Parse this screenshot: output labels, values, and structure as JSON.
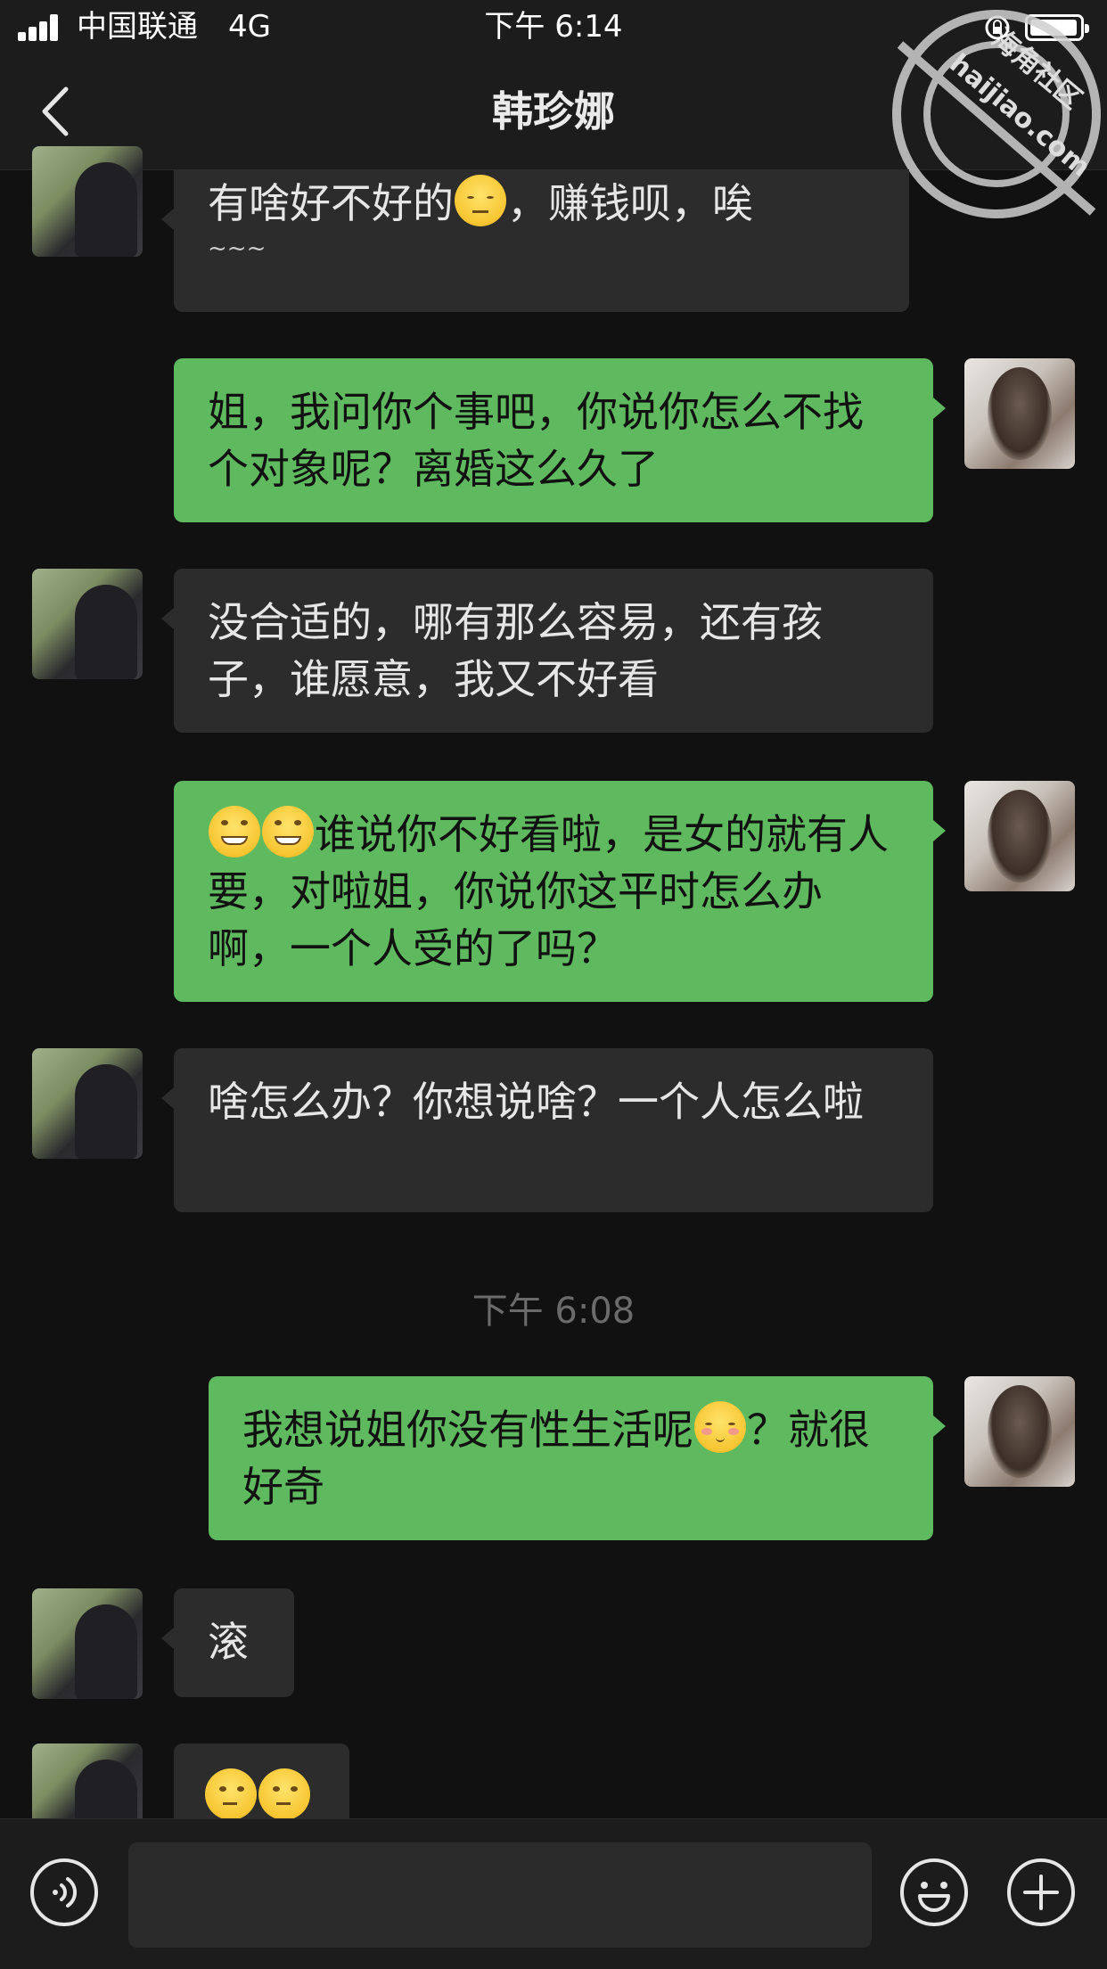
{
  "status_bar": {
    "carrier": "中国联通",
    "network": "4G",
    "time": "下午 6:14",
    "icons": [
      "signal-icon",
      "orientation-lock-icon",
      "battery-icon"
    ]
  },
  "nav": {
    "title": "韩珍娜",
    "back_icon": "chevron-left-icon"
  },
  "watermark": {
    "line1": "海角社区",
    "line2": "haijiao.com"
  },
  "messages": [
    {
      "sender": "her",
      "text": "有啥好不好的",
      "emoji_after": "pensive-face",
      "text2": "，赚钱呗，唉",
      "decor": "~~~"
    },
    {
      "sender": "me",
      "text": "姐，我问你个事吧，你说你怎么不找个对象呢？离婚这么久了"
    },
    {
      "sender": "her",
      "text": "没合适的，哪有那么容易，还有孩子，谁愿意，我又不好看"
    },
    {
      "sender": "me",
      "emoji_before": [
        "grinning-face",
        "grinning-face"
      ],
      "text": "谁说你不好看啦，是女的就有人要，对啦姐，你说你这平时怎么办啊，一个人受的了吗？"
    },
    {
      "sender": "her",
      "text": "啥怎么办？你想说啥？一个人怎么啦"
    },
    {
      "sender": "me",
      "text": "我想说姐你没有性生活呢",
      "emoji_after": "embarrassed-face",
      "text2": "？就很好奇"
    },
    {
      "sender": "her",
      "text": "滚"
    },
    {
      "sender": "her",
      "emoji_only": [
        "thinking-face",
        "thinking-face"
      ]
    }
  ],
  "timestamp_divider": "下午 6:08",
  "input_bar": {
    "voice_icon": "voice-icon",
    "emoji_icon": "emoji-icon",
    "plus_icon": "plus-icon",
    "input_value": ""
  },
  "colors": {
    "background": "#111111",
    "bar": "#1c1c1c",
    "bubble_her": "#2c2c2c",
    "bubble_me": "#5fb95f",
    "timestamp": "#6b6b6b"
  }
}
